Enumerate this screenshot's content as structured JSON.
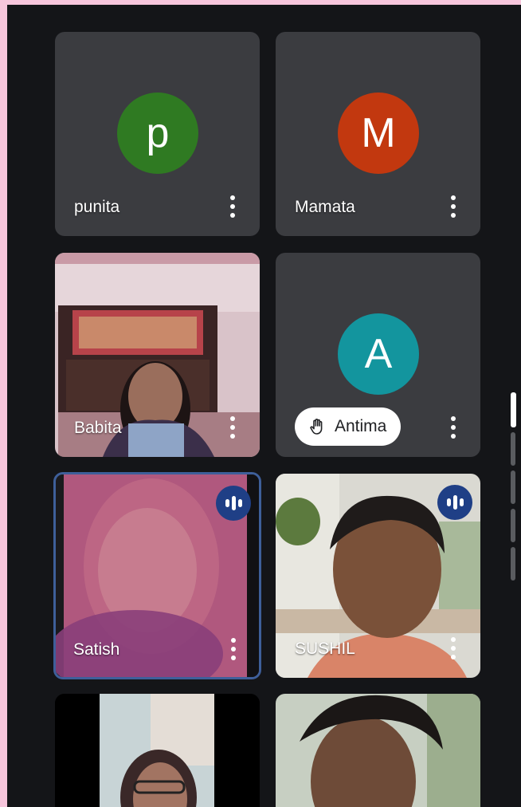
{
  "participants": [
    {
      "name": "punita",
      "initial": "p",
      "color": "#2f7a22",
      "type": "avatar"
    },
    {
      "name": "Mamata",
      "initial": "M",
      "color": "#c2380f",
      "type": "avatar"
    },
    {
      "name": "Babita",
      "type": "video"
    },
    {
      "name": "Antima",
      "initial": "A",
      "color": "#13959e",
      "type": "avatar",
      "hand_raised": true
    },
    {
      "name": "Satish",
      "type": "video",
      "speaking": true,
      "pinned": true
    },
    {
      "name": "SUSHIL",
      "type": "video",
      "speaking": true
    },
    {
      "name": "",
      "type": "video"
    },
    {
      "name": "",
      "type": "video"
    }
  ],
  "icons": {
    "more": "more-vert-icon",
    "speaking": "audio-level-icon",
    "hand": "raised-hand-icon"
  },
  "colors": {
    "background": "#141518",
    "tile": "#3b3c40",
    "active_border": "#3e5f9a",
    "speaking_badge": "#1f3f86"
  }
}
